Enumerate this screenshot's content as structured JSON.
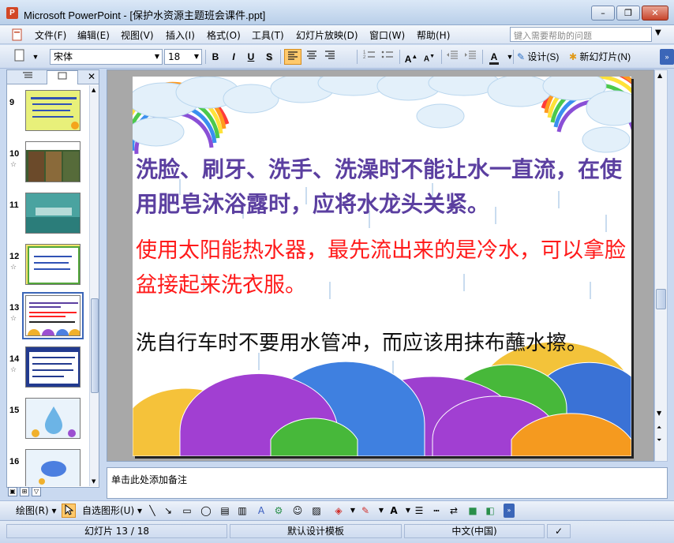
{
  "window": {
    "app_icon": "P",
    "title": "Microsoft PowerPoint - [保护水资源主题班会课件.ppt]",
    "controls": {
      "minimize": "–",
      "restore": "❐",
      "close": "✕"
    }
  },
  "menu": {
    "items": [
      "文件(F)",
      "编辑(E)",
      "视图(V)",
      "插入(I)",
      "格式(O)",
      "工具(T)",
      "幻灯片放映(D)",
      "窗口(W)",
      "帮助(H)"
    ],
    "help_placeholder": "键入需要帮助的问题"
  },
  "toolbar": {
    "font_name": "宋体",
    "font_size": "18",
    "bold": "B",
    "italic": "I",
    "underline": "U",
    "shadow": "S",
    "design_label": "设计(S)",
    "new_slide_label": "新幻灯片(N)"
  },
  "left_panel": {
    "tab_outline_icon": "outline-icon",
    "tab_slides_icon": "slides-icon",
    "close": "✕",
    "thumbnails": [
      {
        "num": "9",
        "star": "",
        "bg": "#e8f07a",
        "selected": false
      },
      {
        "num": "10",
        "star": "☆",
        "bg": "#3d5a2f",
        "selected": false
      },
      {
        "num": "11",
        "star": "",
        "bg": "#4aa3a0",
        "selected": false
      },
      {
        "num": "12",
        "star": "☆",
        "bg": "#f2e56b",
        "selected": false
      },
      {
        "num": "13",
        "star": "☆",
        "bg": "#ffffff",
        "selected": true
      },
      {
        "num": "14",
        "star": "☆",
        "bg": "#223a8f",
        "selected": false
      },
      {
        "num": "15",
        "star": "",
        "bg": "#eaf3fb",
        "selected": false
      },
      {
        "num": "16",
        "star": "",
        "bg": "#eaf3fb",
        "selected": false
      }
    ]
  },
  "slide": {
    "para1": "洗脸、刷牙、洗手、洗澡时不能让水一直流，在使用肥皂沐浴露时，应将水龙头关紧。",
    "para2": "使用太阳能热水器，最先流出来的是冷水，可以拿脸盆接起来洗衣服。",
    "para3": "洗自行车时不要用水管冲，而应该用抹布蘸水擦。",
    "colors": {
      "para1": "#5b3fa0",
      "para2": "#ff1a1a",
      "para3": "#111111"
    }
  },
  "notes": {
    "placeholder": "单击此处添加备注"
  },
  "draw_toolbar": {
    "draw_label": "绘图(R)",
    "autoshape_label": "自选图形(U)"
  },
  "status": {
    "slide_position": "幻灯片 13 / 18",
    "template": "默认设计模板",
    "language": "中文(中国)"
  }
}
